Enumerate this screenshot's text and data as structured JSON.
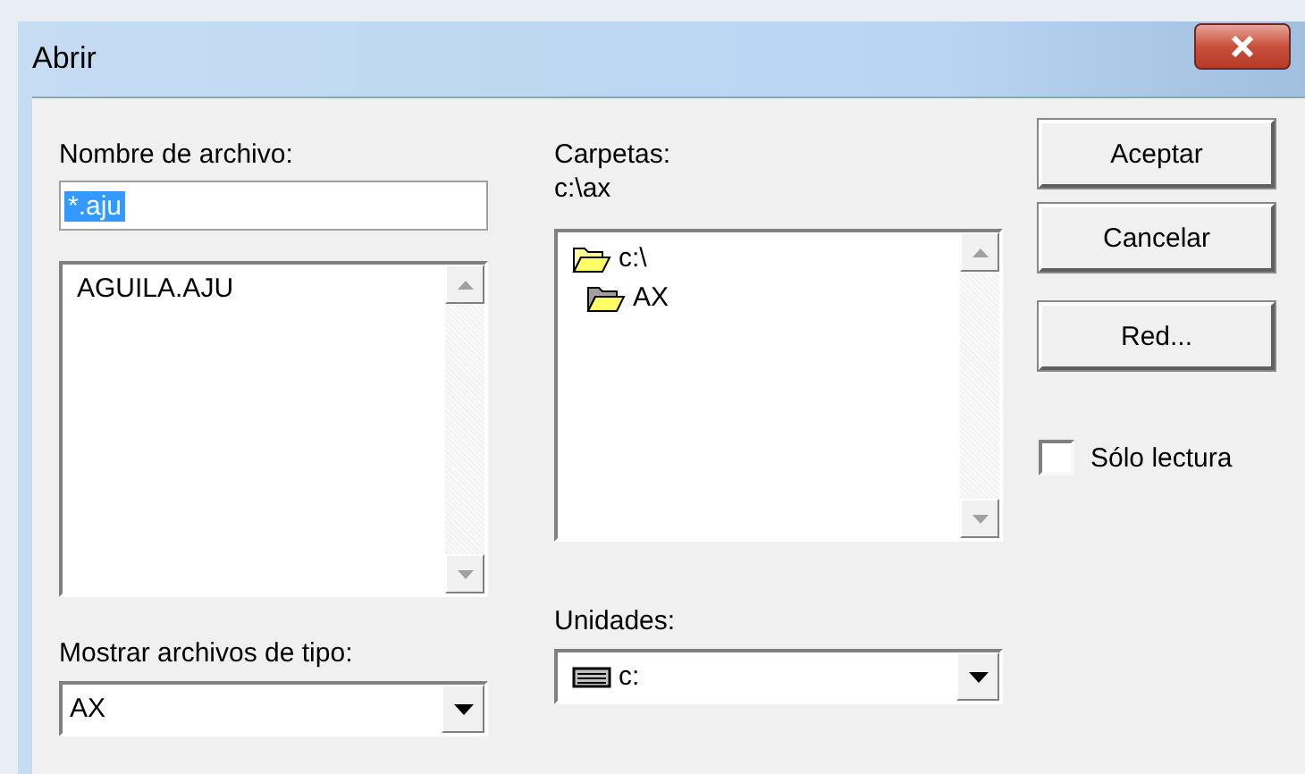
{
  "window": {
    "title": "Abrir"
  },
  "file_name": {
    "label": "Nombre de archivo:",
    "value": "*.aju",
    "selected": true
  },
  "files": [
    {
      "name": "AGUILA.AJU",
      "selected": false
    }
  ],
  "folders_label": "Carpetas:",
  "current_folder": "c:\\ax",
  "folders": [
    {
      "name": "c:\\",
      "expanded": true,
      "children": [
        {
          "name": "AX",
          "expanded": true
        }
      ]
    }
  ],
  "file_type": {
    "label": "Mostrar archivos de tipo:",
    "value": "AX"
  },
  "drives": {
    "label": "Unidades:",
    "value": "c:"
  },
  "buttons": [
    "Aceptar",
    "Cancelar",
    "Red..."
  ],
  "read_only": {
    "label": "Sólo lectura",
    "checked": false
  }
}
